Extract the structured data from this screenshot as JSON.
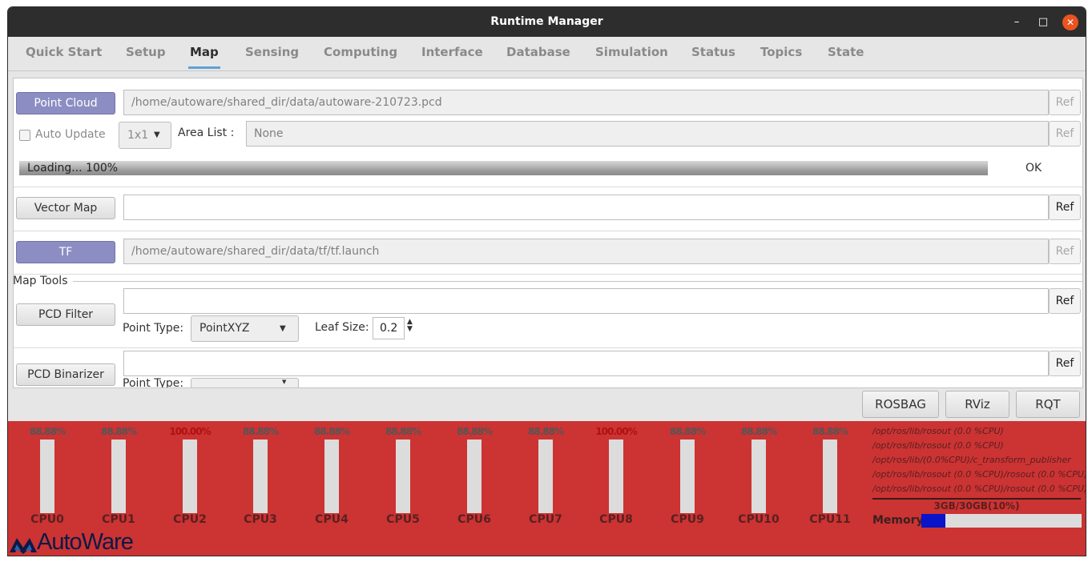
{
  "window": {
    "title": "Runtime Manager",
    "minimize": "–",
    "maximize": "□",
    "close": "✕"
  },
  "tabs": [
    "Quick Start",
    "Setup",
    "Map",
    "Sensing",
    "Computing",
    "Interface",
    "Database",
    "Simulation",
    "Status",
    "Topics",
    "State"
  ],
  "active_tab": "Map",
  "map": {
    "point_cloud": {
      "button": "Point Cloud",
      "path": "/home/autoware/shared_dir/data/autoware-210723.pcd",
      "ref": "Ref",
      "auto_update": "Auto Update",
      "grid": "1x1",
      "area_list_label": "Area List :",
      "area_list_value": "None",
      "area_ref": "Ref",
      "progress_text": "Loading...  100%",
      "progress": 100,
      "status": "OK"
    },
    "vector_map": {
      "button": "Vector Map",
      "path": "",
      "ref": "Ref"
    },
    "tf": {
      "button": "TF",
      "path": "/home/autoware/shared_dir/data/tf/tf.launch",
      "ref": "Ref"
    },
    "map_tools": {
      "title": "Map Tools",
      "pcd_filter": {
        "button": "PCD Filter",
        "path": "",
        "ref": "Ref",
        "point_type_label": "Point Type:",
        "point_type": "PointXYZ",
        "leaf_size_label": "Leaf Size:",
        "leaf_size": "0.2"
      },
      "pcd_binarizer": {
        "button": "PCD Binarizer",
        "path": "",
        "ref": "Ref",
        "point_type_label": "Point Type:"
      }
    }
  },
  "bottom_buttons": {
    "rosbag": "ROSBAG",
    "rviz": "RViz",
    "rqt": "RQT"
  },
  "cpus": [
    {
      "name": "CPU0",
      "pct": "88.88%",
      "hot": false
    },
    {
      "name": "CPU1",
      "pct": "88.88%",
      "hot": false
    },
    {
      "name": "CPU2",
      "pct": "100.00%",
      "hot": true
    },
    {
      "name": "CPU3",
      "pct": "88.88%",
      "hot": false
    },
    {
      "name": "CPU4",
      "pct": "88.88%",
      "hot": false
    },
    {
      "name": "CPU5",
      "pct": "88.88%",
      "hot": false
    },
    {
      "name": "CPU6",
      "pct": "88.88%",
      "hot": false
    },
    {
      "name": "CPU7",
      "pct": "88.88%",
      "hot": false
    },
    {
      "name": "CPU8",
      "pct": "100.00%",
      "hot": true
    },
    {
      "name": "CPU9",
      "pct": "88.88%",
      "hot": false
    },
    {
      "name": "CPU10",
      "pct": "88.88%",
      "hot": false
    },
    {
      "name": "CPU11",
      "pct": "88.88%",
      "hot": false
    }
  ],
  "processes": [
    "/opt/ros/lib/rosout (0.0 %CPU)",
    "/opt/ros/lib/rosout (0.0 %CPU)",
    "/opt/ros/lib/(0.0%CPU)/c_transform_publisher",
    "/opt/ros/lib/rosout (0.0 %CPU)/rosout (0.0 %CPU)",
    "/opt/ros/lib/rosout (0.0 %CPU)/rosout (0.0 %CPU)"
  ],
  "memory": {
    "label": "Memory",
    "text": "3GB/30GB(10%)",
    "fraction": 0.15
  },
  "logo": {
    "text": "AutoWare"
  },
  "colors": {
    "status_bg": "#cc3333",
    "active_tab": "#5fa1d8",
    "toggle_on": "#8c8dc3",
    "memory_fill": "#0a14c8"
  }
}
